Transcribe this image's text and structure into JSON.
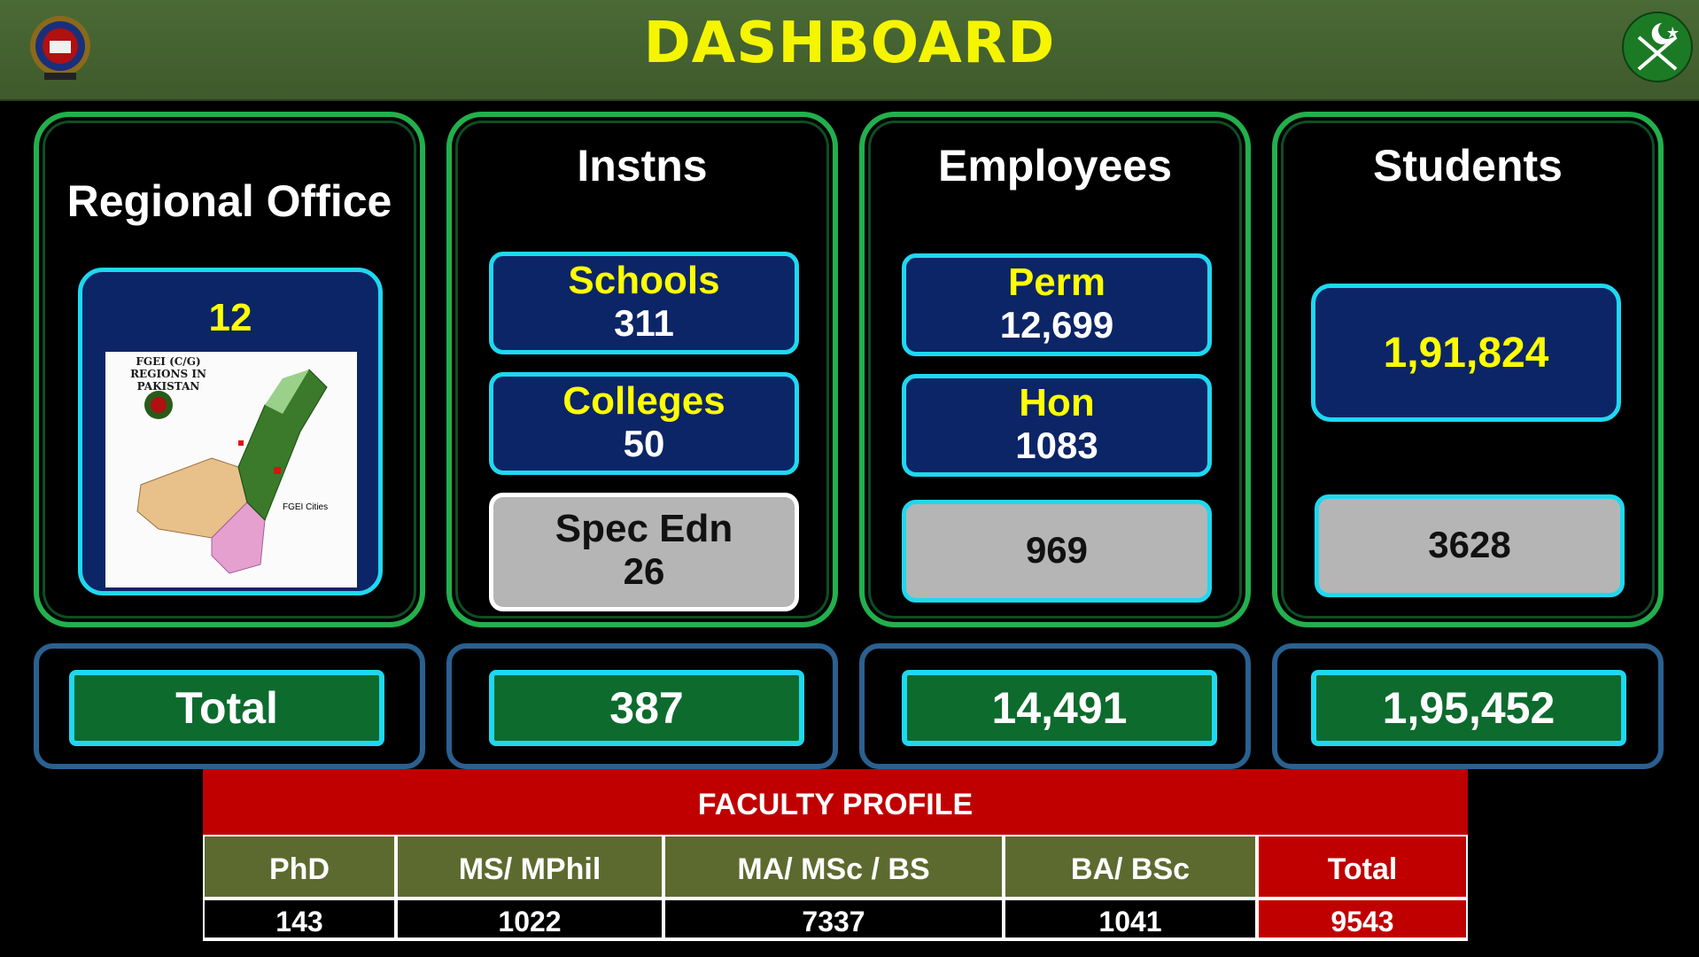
{
  "header": {
    "title": "DASHBOARD"
  },
  "regional": {
    "title": "Regional Office",
    "count": "12",
    "map_caption": "FGEI (C/G) REGIONS IN PAKISTAN",
    "map_legend": "FGEI Cities"
  },
  "instns": {
    "title": "Instns",
    "schools_label": "Schools",
    "schools_value": "311",
    "colleges_label": "Colleges",
    "colleges_value": "50",
    "spec_label": "Spec Edn",
    "spec_value": "26",
    "total": "387"
  },
  "employees": {
    "title": "Employees",
    "perm_label": "Perm",
    "perm_value": "12,699",
    "hon_label": "Hon",
    "hon_value": "1083",
    "other_value": "969",
    "total": "14,491"
  },
  "students": {
    "title": "Students",
    "main_value": "1,91,824",
    "other_value": "3628",
    "total": "1,95,452"
  },
  "total_label": "Total",
  "faculty": {
    "title": "FACULTY PROFILE",
    "headers": [
      "PhD",
      "MS/ MPhil",
      "MA/ MSc / BS",
      "BA/ BSc",
      "Total"
    ],
    "values": [
      "143",
      "1022",
      "7337",
      "1041",
      "9543"
    ]
  },
  "colors": {
    "accent_green": "#22b04c",
    "tile_blue": "#0c2566",
    "cyan": "#1fd8f0",
    "title_yellow": "#f5f500",
    "red": "#c00000"
  }
}
